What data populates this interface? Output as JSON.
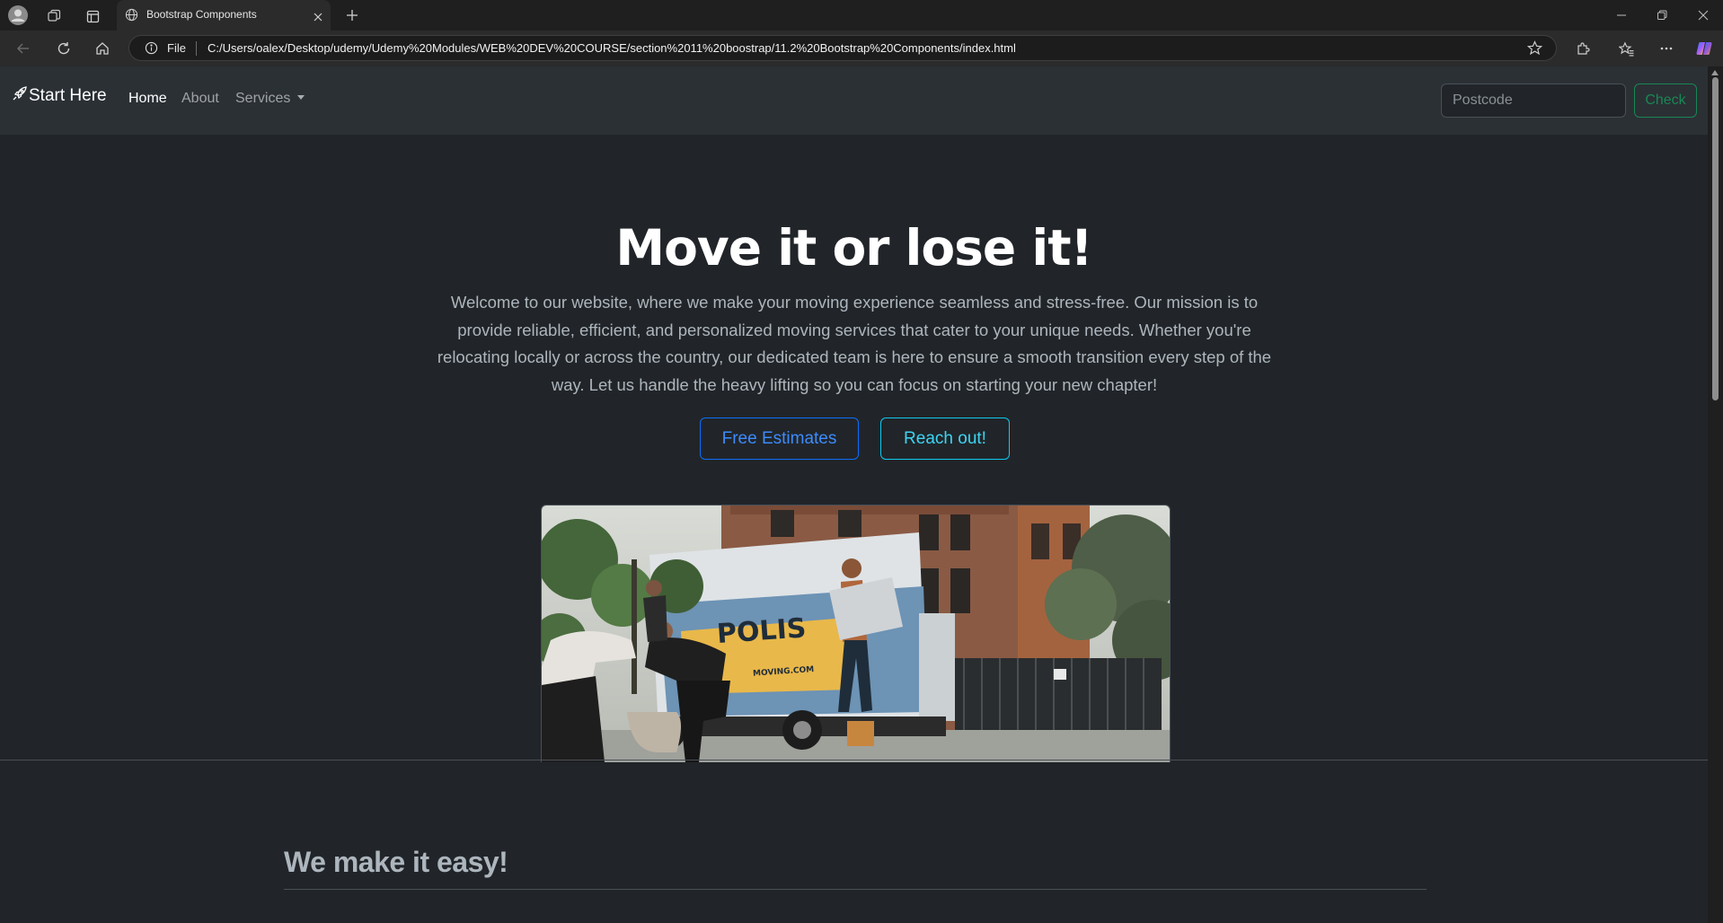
{
  "browser": {
    "tab_title": "Bootstrap Components",
    "omnibox_scheme": "File",
    "url": "C:/Users/oalex/Desktop/udemy/Udemy%20Modules/WEB%20DEV%20COURSE/section%2011%20boostrap/11.2%20Bootstrap%20Components/index.html"
  },
  "navbar": {
    "brand": "Start Here",
    "links": [
      "Home",
      "About",
      "Services"
    ],
    "postcode_placeholder": "Postcode",
    "check_label": "Check"
  },
  "hero": {
    "title": "Move it or lose it!",
    "text": "Welcome to our website, where we make your moving experience seamless and stress-free. Our mission is to provide reliable, efficient, and personalized moving services that cater to your unique needs. Whether you're relocating locally or across the country, our dedicated team is here to ensure a smooth transition every step of the way. Let us handle the heavy lifting so you can focus on starting your new chapter!",
    "btn_estimates": "Free Estimates",
    "btn_reach": "Reach out!"
  },
  "photo": {
    "truck_text": "POLIS",
    "truck_small_text": "MOVING.COM"
  },
  "section": {
    "title": "We make it easy!"
  }
}
